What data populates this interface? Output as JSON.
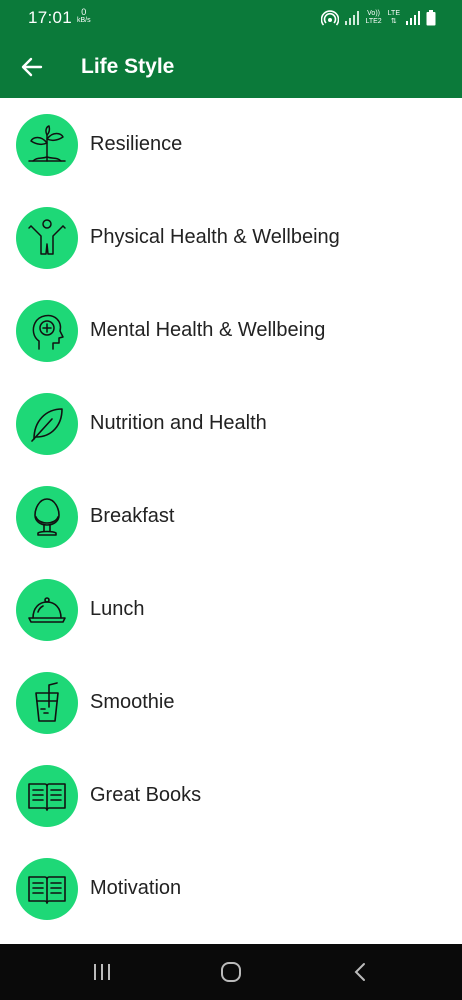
{
  "status_bar": {
    "time": "17:01",
    "speed_value": "0",
    "speed_unit": "kB/s",
    "network_1": "Vo))",
    "network_2": "LTE2",
    "network_3": "LTE"
  },
  "app_bar": {
    "title": "Life Style"
  },
  "items": [
    {
      "label": "Resilience",
      "icon": "plant-icon"
    },
    {
      "label": "Physical Health & Wellbeing",
      "icon": "person-icon"
    },
    {
      "label": "Mental Health & Wellbeing",
      "icon": "head-icon"
    },
    {
      "label": "Nutrition and Health",
      "icon": "leaf-icon"
    },
    {
      "label": "Breakfast",
      "icon": "egg-icon"
    },
    {
      "label": "Lunch",
      "icon": "cloche-icon"
    },
    {
      "label": "Smoothie",
      "icon": "glass-icon"
    },
    {
      "label": "Great Books",
      "icon": "book-icon"
    },
    {
      "label": "Motivation",
      "icon": "book-icon"
    }
  ],
  "colors": {
    "header": "#0b7a3a",
    "icon_bg": "#1ed877",
    "nav_bar": "#0a0a0a"
  }
}
